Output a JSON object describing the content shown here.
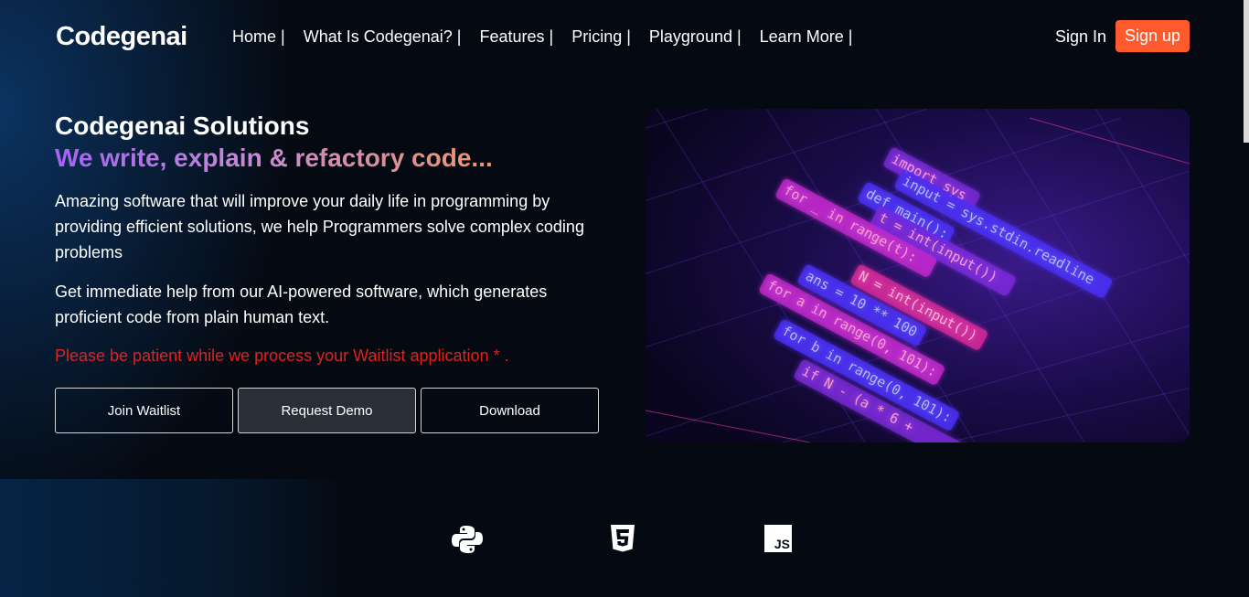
{
  "header": {
    "logo": "Codegenai",
    "nav": [
      {
        "label": "Home |"
      },
      {
        "label": "What Is Codegenai? |"
      },
      {
        "label": "Features |"
      },
      {
        "label": "Pricing |"
      },
      {
        "label": "Playground |"
      },
      {
        "label": "Learn More |"
      }
    ],
    "sign_in": "Sign In",
    "sign_up": "Sign up",
    "accent_color": "#ff5a2c"
  },
  "hero": {
    "title": "Codegenai Solutions",
    "tagline": "We write, explain & refactory code...",
    "paragraph1": "Amazing software that will improve your daily life in programming by providing efficient solutions, we help Programmers solve complex coding problems",
    "paragraph2": "Get immediate help from our AI-powered software, which generates proficient code from plain human text.",
    "notice": "Please be patient while we process your Waitlist application * .",
    "notice_color": "#e0221f",
    "buttons": {
      "join": "Join Waitlist",
      "demo": "Request Demo",
      "download": "Download"
    },
    "image_code": [
      "import sys",
      "input = sys.stdin.readline",
      "def main():",
      "t = int(input())",
      "for _ in range(t):",
      "N = int(input())",
      "ans = 10 ** 100",
      "for a in range(0, 101):",
      "for b in range(0, 101):",
      "if N - (a * 6 +"
    ]
  },
  "languages": {
    "icons": [
      "python-icon",
      "html5-icon",
      "javascript-icon"
    ],
    "js_label": "JS"
  }
}
